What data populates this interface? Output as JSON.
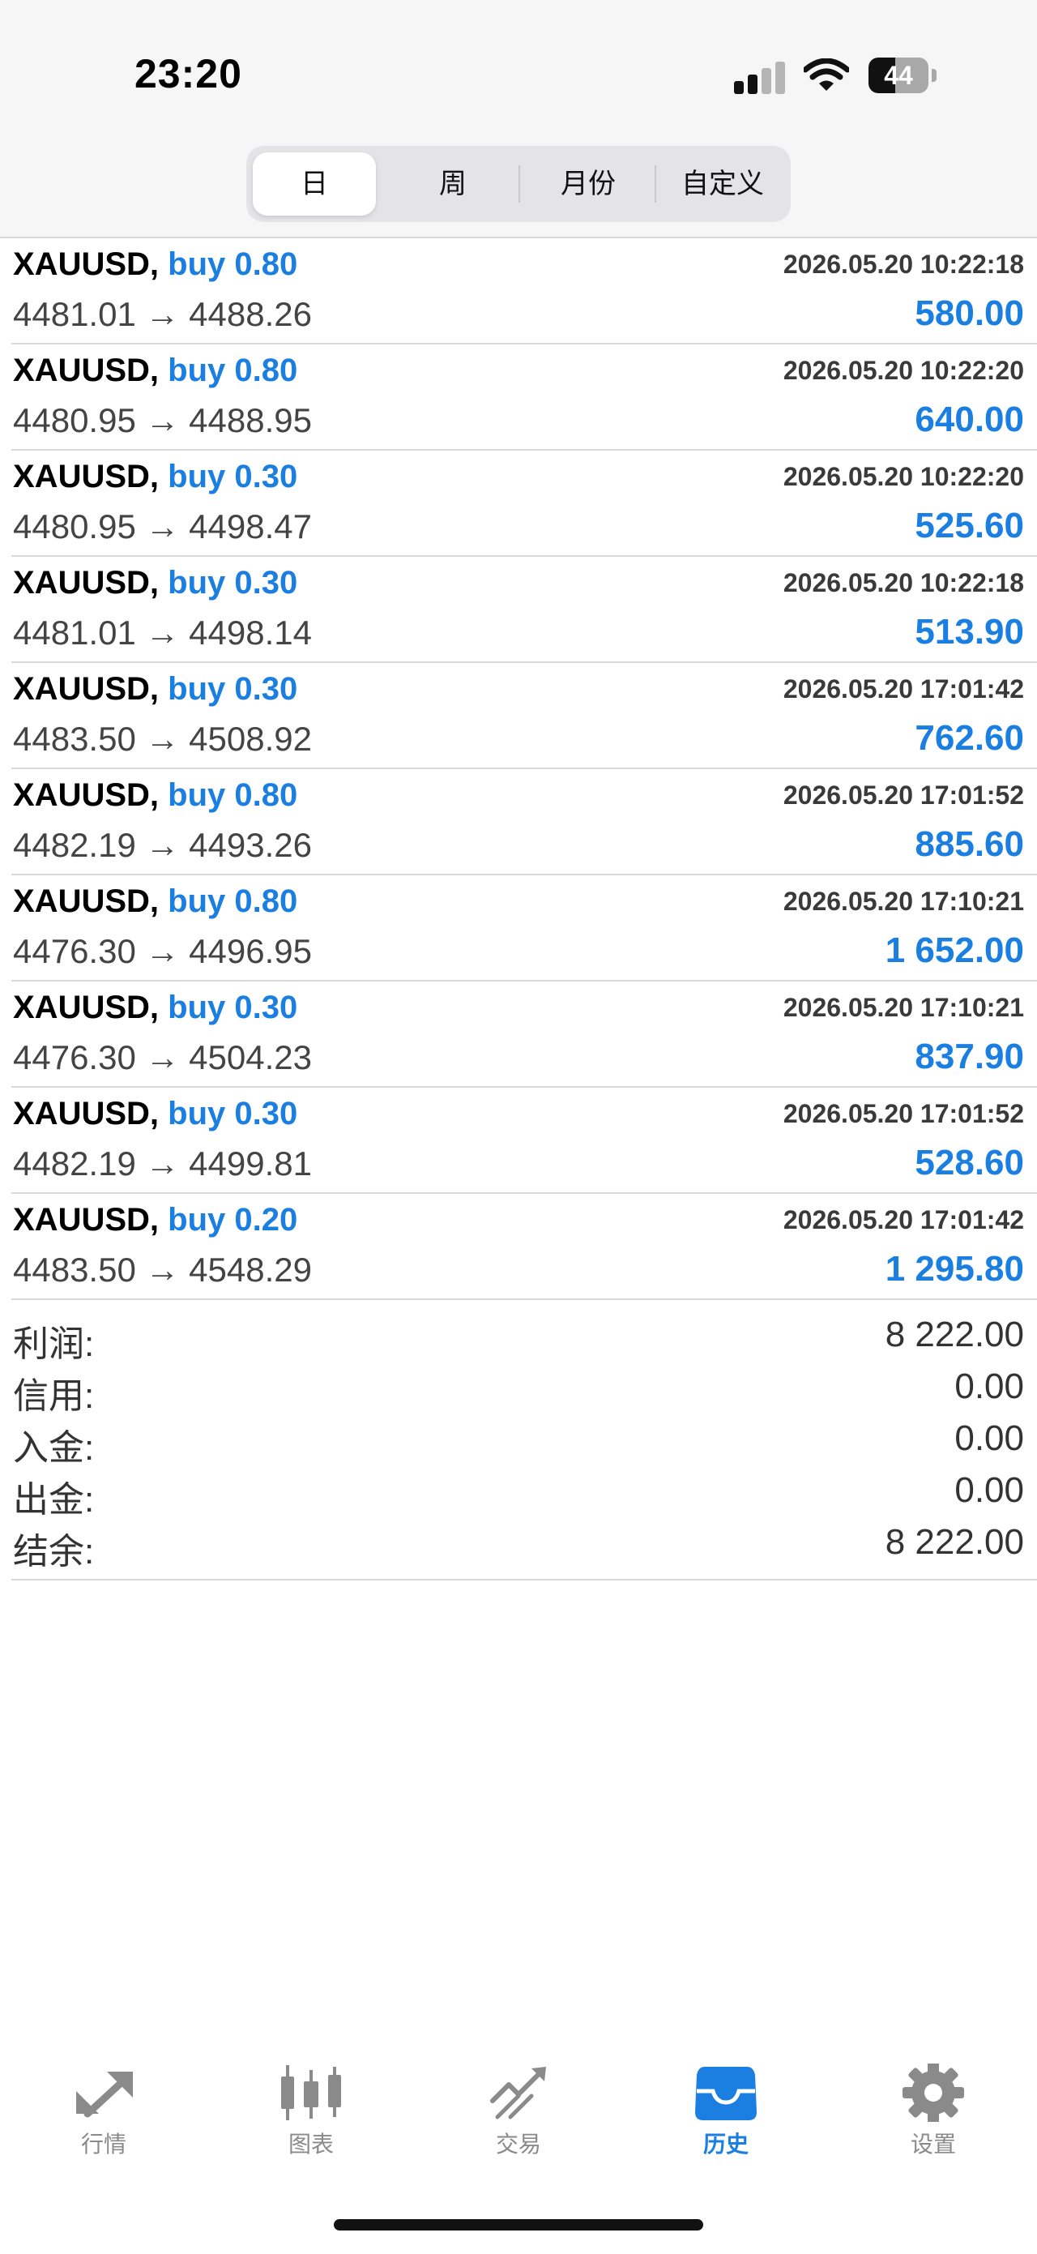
{
  "status_bar": {
    "time": "23:20",
    "battery": "44"
  },
  "tabs": [
    {
      "label": "日",
      "active": true
    },
    {
      "label": "周",
      "active": false
    },
    {
      "label": "月份",
      "active": false
    },
    {
      "label": "自定义",
      "active": false
    }
  ],
  "trades": [
    {
      "symbol": "XAUUSD,",
      "side": "buy 0.80",
      "time": "2026.05.20 10:22:18",
      "prices": "4481.01 → 4488.26",
      "profit": "580.00"
    },
    {
      "symbol": "XAUUSD,",
      "side": "buy 0.80",
      "time": "2026.05.20 10:22:20",
      "prices": "4480.95 → 4488.95",
      "profit": "640.00"
    },
    {
      "symbol": "XAUUSD,",
      "side": "buy 0.30",
      "time": "2026.05.20 10:22:20",
      "prices": "4480.95 → 4498.47",
      "profit": "525.60"
    },
    {
      "symbol": "XAUUSD,",
      "side": "buy 0.30",
      "time": "2026.05.20 10:22:18",
      "prices": "4481.01 → 4498.14",
      "profit": "513.90"
    },
    {
      "symbol": "XAUUSD,",
      "side": "buy 0.30",
      "time": "2026.05.20 17:01:42",
      "prices": "4483.50 → 4508.92",
      "profit": "762.60"
    },
    {
      "symbol": "XAUUSD,",
      "side": "buy 0.80",
      "time": "2026.05.20 17:01:52",
      "prices": "4482.19 → 4493.26",
      "profit": "885.60"
    },
    {
      "symbol": "XAUUSD,",
      "side": "buy 0.80",
      "time": "2026.05.20 17:10:21",
      "prices": "4476.30 → 4496.95",
      "profit": "1 652.00"
    },
    {
      "symbol": "XAUUSD,",
      "side": "buy 0.30",
      "time": "2026.05.20 17:10:21",
      "prices": "4476.30 → 4504.23",
      "profit": "837.90"
    },
    {
      "symbol": "XAUUSD,",
      "side": "buy 0.30",
      "time": "2026.05.20 17:01:52",
      "prices": "4482.19 → 4499.81",
      "profit": "528.60"
    },
    {
      "symbol": "XAUUSD,",
      "side": "buy 0.20",
      "time": "2026.05.20 17:01:42",
      "prices": "4483.50 → 4548.29",
      "profit": "1 295.80"
    }
  ],
  "summary": [
    {
      "label": "利润:",
      "value": "8 222.00"
    },
    {
      "label": "信用:",
      "value": "0.00"
    },
    {
      "label": "入金:",
      "value": "0.00"
    },
    {
      "label": "出金:",
      "value": "0.00"
    },
    {
      "label": "结余:",
      "value": "8 222.00"
    }
  ],
  "tabbar": [
    {
      "label": "行情",
      "icon": "quotes-icon",
      "active": false
    },
    {
      "label": "图表",
      "icon": "chart-icon",
      "active": false
    },
    {
      "label": "交易",
      "icon": "trade-icon",
      "active": false
    },
    {
      "label": "历史",
      "icon": "history-icon",
      "active": true
    },
    {
      "label": "设置",
      "icon": "settings-icon",
      "active": false
    }
  ],
  "colors": {
    "accent": "#1a7fe0",
    "inactive": "#8a8a8a"
  }
}
